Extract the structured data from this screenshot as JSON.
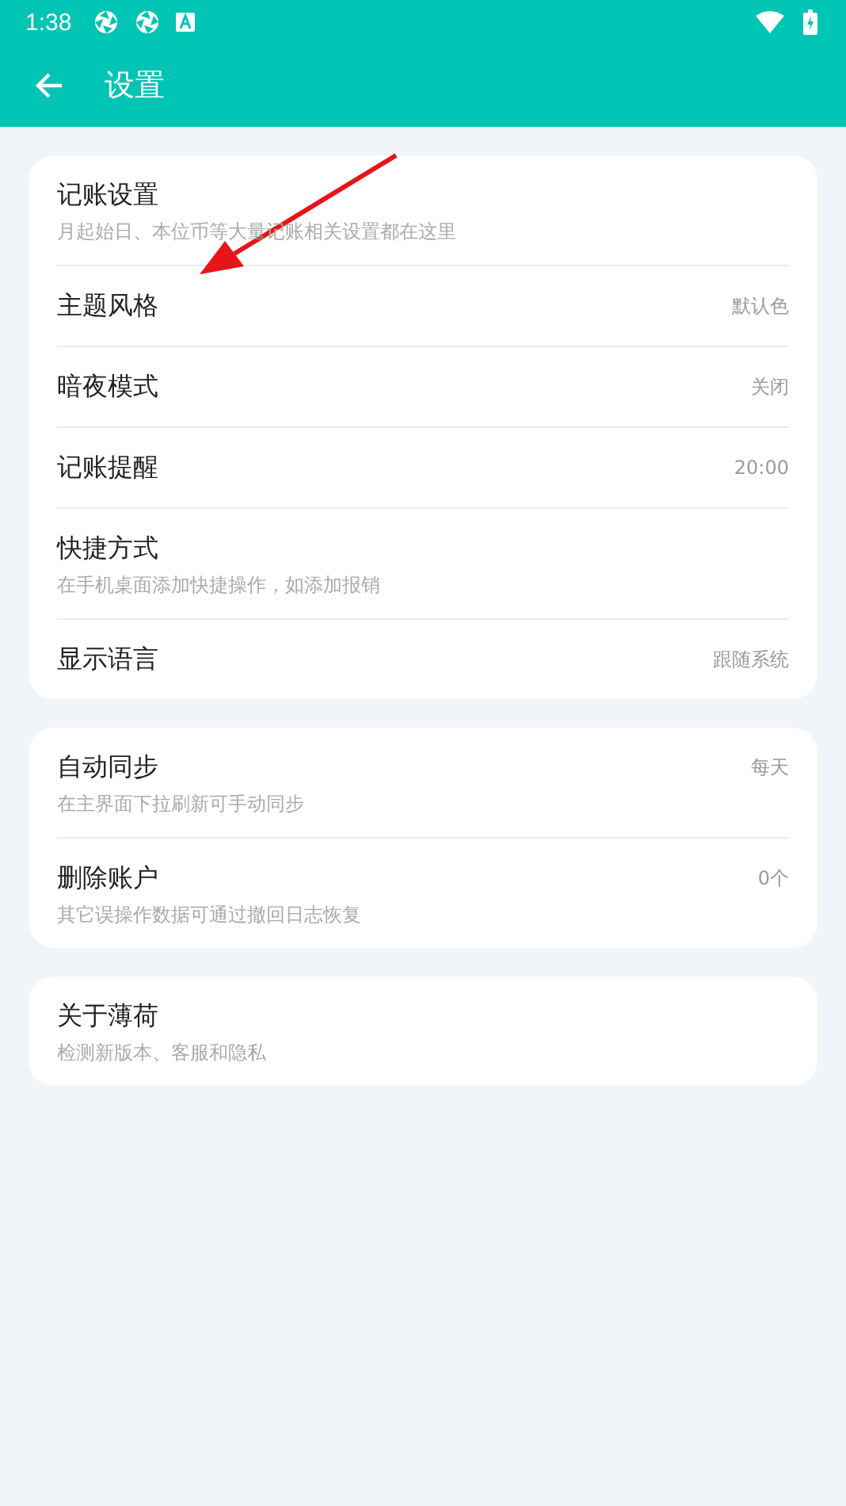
{
  "status_bar": {
    "time": "1:38"
  },
  "app_bar": {
    "title": "设置"
  },
  "groups": [
    {
      "items": [
        {
          "title": "记账设置",
          "subtitle": "月起始日、本位币等大量记账相关设置都在这里"
        },
        {
          "title": "主题风格",
          "value": "默认色"
        },
        {
          "title": "暗夜模式",
          "value": "关闭"
        },
        {
          "title": "记账提醒",
          "value": "20:00"
        },
        {
          "title": "快捷方式",
          "subtitle": "在手机桌面添加快捷操作，如添加报销"
        },
        {
          "title": "显示语言",
          "value": "跟随系统"
        }
      ]
    },
    {
      "items": [
        {
          "title": "自动同步",
          "subtitle": "在主界面下拉刷新可手动同步",
          "value": "每天"
        },
        {
          "title": "删除账户",
          "subtitle": "其它误操作数据可通过撤回日志恢复",
          "value": "0个"
        }
      ]
    },
    {
      "items": [
        {
          "title": "关于薄荷",
          "subtitle": "检测新版本、客服和隐私"
        }
      ]
    }
  ]
}
